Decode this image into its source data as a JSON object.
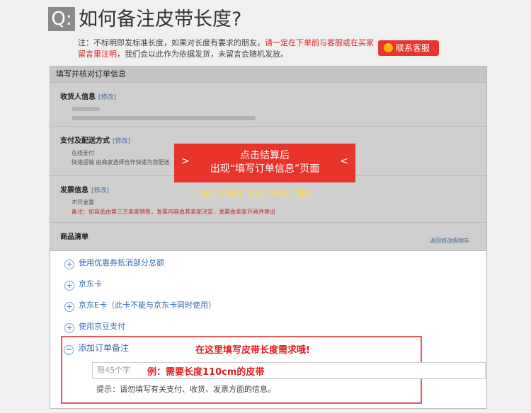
{
  "header": {
    "badge": "Q:",
    "title": "如何备注皮带长度?"
  },
  "note": {
    "part1": "注：不标明即发标准长度，如果对长度有要求的朋友，",
    "red": "请一定在下单前与客服或在买家留言里注明",
    "part2": "，我们会以此作为依据发货，未留言会随机发放。"
  },
  "contact_button": {
    "label": "联系客服"
  },
  "order_shot": {
    "header": "填写并核对订单信息",
    "sections": [
      {
        "title": "收货人信息",
        "modify": "[修改]"
      },
      {
        "title": "支付及配送方式",
        "modify": "[修改]",
        "lines": [
          "在线支付",
          "快递运输 由商家选择合作快递为您配送"
        ]
      },
      {
        "title": "发票信息",
        "modify": "[修改]",
        "lines": [
          "不开发票"
        ],
        "red_line": "备注：如商品由第三方卖家销售，发票内容由其卖家决定，发票由卖家开具并寄出"
      },
      {
        "title": "商品清单"
      }
    ],
    "back_link": "返回修改购物车"
  },
  "callout": {
    "line1": "点击结算后",
    "line2": "出现“填写订单信息”页面",
    "arrow_left": ">",
    "arrow_right": "<"
  },
  "yellow_note": "页面左下角有“添加订单备注”选项",
  "options": [
    {
      "label": "使用优惠券抵消部分总额"
    },
    {
      "label": "京东卡"
    },
    {
      "label": "京东E卡（此卡不能与京东卡同时使用）"
    },
    {
      "label": "使用京豆支付"
    }
  ],
  "remark": {
    "label": "添加订单备注",
    "hint": "在这里填写皮带长度需求哦!",
    "placeholder": "限45个字",
    "example": "例：需要长度110cm的皮带",
    "tip": "提示：请勿填写有关支付、收货、发票方面的信息。"
  },
  "colors": {
    "accent_red": "#e8342a",
    "link_blue": "#3a6fb0",
    "highlight_yellow": "#ffd84a"
  }
}
